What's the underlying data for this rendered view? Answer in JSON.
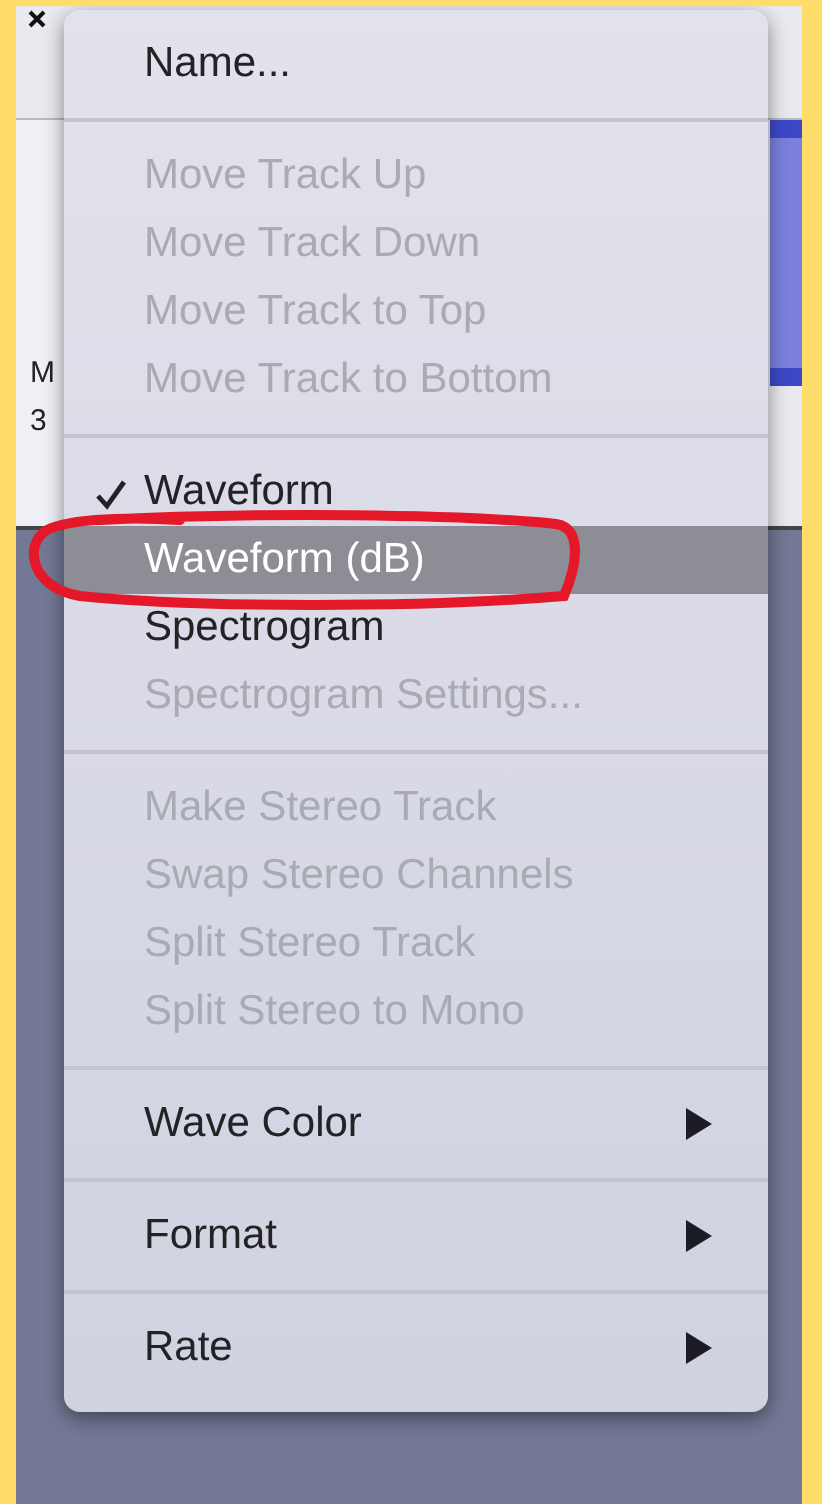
{
  "track_panel": {
    "labels": [
      "M",
      "3"
    ]
  },
  "menu": {
    "items": [
      {
        "kind": "item",
        "label": "Name...",
        "disabled": false,
        "checked": false,
        "selected": false,
        "submenu": false,
        "circled": false
      },
      {
        "kind": "separator"
      },
      {
        "kind": "item",
        "label": "Move Track Up",
        "disabled": true,
        "checked": false,
        "selected": false,
        "submenu": false,
        "circled": false
      },
      {
        "kind": "item",
        "label": "Move Track Down",
        "disabled": true,
        "checked": false,
        "selected": false,
        "submenu": false,
        "circled": false
      },
      {
        "kind": "item",
        "label": "Move Track to Top",
        "disabled": true,
        "checked": false,
        "selected": false,
        "submenu": false,
        "circled": false
      },
      {
        "kind": "item",
        "label": "Move Track to Bottom",
        "disabled": true,
        "checked": false,
        "selected": false,
        "submenu": false,
        "circled": false
      },
      {
        "kind": "separator"
      },
      {
        "kind": "item",
        "label": "Waveform",
        "disabled": false,
        "checked": true,
        "selected": false,
        "submenu": false,
        "circled": false
      },
      {
        "kind": "item",
        "label": "Waveform (dB)",
        "disabled": false,
        "checked": false,
        "selected": true,
        "submenu": false,
        "circled": true
      },
      {
        "kind": "item",
        "label": "Spectrogram",
        "disabled": false,
        "checked": false,
        "selected": false,
        "submenu": false,
        "circled": false
      },
      {
        "kind": "item",
        "label": "Spectrogram Settings...",
        "disabled": true,
        "checked": false,
        "selected": false,
        "submenu": false,
        "circled": false
      },
      {
        "kind": "separator"
      },
      {
        "kind": "item",
        "label": "Make Stereo Track",
        "disabled": true,
        "checked": false,
        "selected": false,
        "submenu": false,
        "circled": false
      },
      {
        "kind": "item",
        "label": "Swap Stereo Channels",
        "disabled": true,
        "checked": false,
        "selected": false,
        "submenu": false,
        "circled": false
      },
      {
        "kind": "item",
        "label": "Split Stereo Track",
        "disabled": true,
        "checked": false,
        "selected": false,
        "submenu": false,
        "circled": false
      },
      {
        "kind": "item",
        "label": "Split Stereo to Mono",
        "disabled": true,
        "checked": false,
        "selected": false,
        "submenu": false,
        "circled": false
      },
      {
        "kind": "separator"
      },
      {
        "kind": "item",
        "label": "Wave Color",
        "disabled": false,
        "checked": false,
        "selected": false,
        "submenu": true,
        "circled": false
      },
      {
        "kind": "separator"
      },
      {
        "kind": "item",
        "label": "Format",
        "disabled": false,
        "checked": false,
        "selected": false,
        "submenu": true,
        "circled": false
      },
      {
        "kind": "separator"
      },
      {
        "kind": "item",
        "label": "Rate",
        "disabled": false,
        "checked": false,
        "selected": false,
        "submenu": true,
        "circled": false
      }
    ]
  }
}
